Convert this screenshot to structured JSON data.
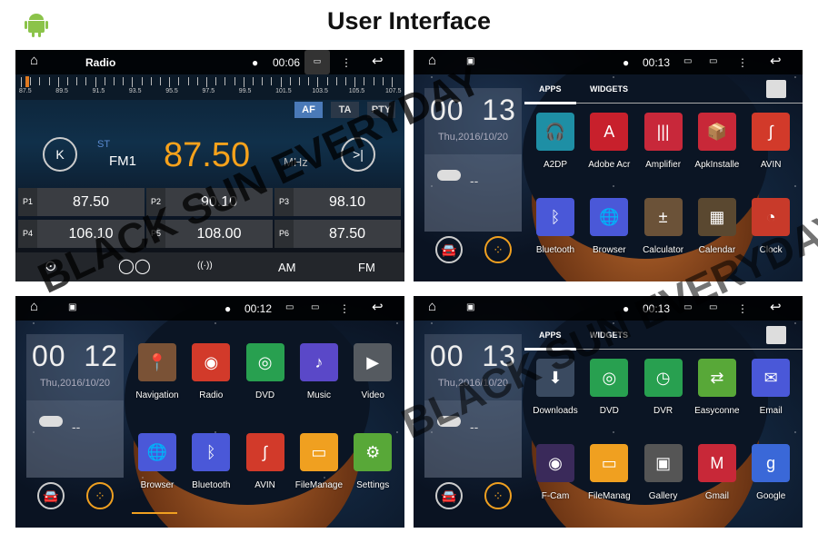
{
  "header": {
    "title": "User Interface",
    "logo": "android-icon"
  },
  "watermark": "BLACK SUN EVERYDAY",
  "radio": {
    "title": "Radio",
    "time": "00:06",
    "scale": [
      "87.5",
      "89.5",
      "91.5",
      "93.5",
      "95.5",
      "97.5",
      "99.5",
      "101.5",
      "103.5",
      "105.5",
      "107.5"
    ],
    "rds": [
      "AF",
      "TA",
      "PTY"
    ],
    "rds_active": "AF",
    "stereo": "ST",
    "band": "FM1",
    "frequency": "87.50",
    "unit": "MHz",
    "presets": [
      {
        "p": "P1",
        "f": "87.50"
      },
      {
        "p": "P2",
        "f": "90.10"
      },
      {
        "p": "P3",
        "f": "98.10"
      },
      {
        "p": "P4",
        "f": "106.10"
      },
      {
        "p": "P5",
        "f": "108.00"
      },
      {
        "p": "P6",
        "f": "87.50"
      }
    ],
    "bottom": {
      "am": "AM",
      "fm": "FM",
      "scan": "search-icon",
      "stereo": "stereo-icon",
      "local": "local-distance-icon"
    },
    "accent": "#f7a21b"
  },
  "drawer1": {
    "time": "00:13",
    "clock_h": "00",
    "clock_m": "13",
    "date": "Thu,2016/10/20",
    "weather": "--",
    "tabs": [
      "APPS",
      "WIDGETS"
    ],
    "apps": [
      {
        "l": "A2DP",
        "c": "#1e8fa5",
        "g": "🎧"
      },
      {
        "l": "Adobe Acr",
        "c": "#c8202c",
        "g": "A"
      },
      {
        "l": "Amplifier",
        "c": "#c8283a",
        "g": "|||"
      },
      {
        "l": "ApkInstalle",
        "c": "#c82838",
        "g": "📦"
      },
      {
        "l": "AVIN",
        "c": "#d23a2a",
        "g": "∫"
      },
      {
        "l": "Bluetooth",
        "c": "#4a58d8",
        "g": "ᛒ"
      },
      {
        "l": "Browser",
        "c": "#4a58d8",
        "g": "🌐"
      },
      {
        "l": "Calculator",
        "c": "#6b5238",
        "g": "±"
      },
      {
        "l": "Calendar",
        "c": "#5a4830",
        "g": "▦"
      },
      {
        "l": "Clock",
        "c": "#c83a2a",
        "g": "◔"
      }
    ]
  },
  "home": {
    "time": "00:12",
    "clock_h": "00",
    "clock_m": "12",
    "date": "Thu,2016/10/20",
    "weather": "--",
    "apps": [
      {
        "l": "Navigation",
        "c": "#7a5236",
        "g": "📍"
      },
      {
        "l": "Radio",
        "c": "#d23a2a",
        "g": "◉"
      },
      {
        "l": "DVD",
        "c": "#28a050",
        "g": "◎"
      },
      {
        "l": "Music",
        "c": "#5a48c8",
        "g": "♪"
      },
      {
        "l": "Video",
        "c": "#555a60",
        "g": "▶"
      },
      {
        "l": "Browser",
        "c": "#4a58d8",
        "g": "🌐"
      },
      {
        "l": "Bluetooth",
        "c": "#4a58d8",
        "g": "ᛒ"
      },
      {
        "l": "AVIN",
        "c": "#d23a2a",
        "g": "∫"
      },
      {
        "l": "FileManage",
        "c": "#f0a020",
        "g": "▭"
      },
      {
        "l": "Settings",
        "c": "#58a838",
        "g": "⚙"
      }
    ]
  },
  "drawer2": {
    "time": "00:13",
    "clock_h": "00",
    "clock_m": "13",
    "date": "Thu,2016/10/20",
    "weather": "--",
    "tabs": [
      "APPS",
      "WIDGETS"
    ],
    "apps": [
      {
        "l": "Downloads",
        "c": "#3a4a60",
        "g": "⬇"
      },
      {
        "l": "DVD",
        "c": "#28a050",
        "g": "◎"
      },
      {
        "l": "DVR",
        "c": "#28a050",
        "g": "◷"
      },
      {
        "l": "Easyconne",
        "c": "#58a838",
        "g": "⇄"
      },
      {
        "l": "Email",
        "c": "#4a58d8",
        "g": "✉"
      },
      {
        "l": "F-Cam",
        "c": "#3a2a5a",
        "g": "◉"
      },
      {
        "l": "FileManag",
        "c": "#f0a020",
        "g": "▭"
      },
      {
        "l": "Gallery",
        "c": "#555",
        "g": "▣"
      },
      {
        "l": "Gmail",
        "c": "#c82838",
        "g": "M"
      },
      {
        "l": "Google",
        "c": "#3a68d8",
        "g": "g"
      }
    ]
  }
}
